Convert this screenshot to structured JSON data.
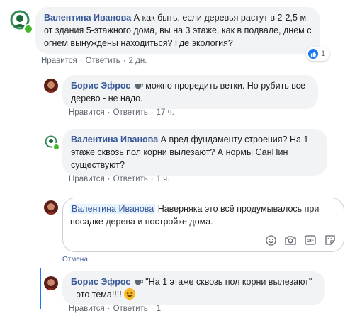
{
  "comments": [
    {
      "author": "Валентина Иванова",
      "text": "А как быть, если деревья растут в 2-2,5 м от здания 5-этажного дома, вы на 3 этаже, как в подвале, днем с огнем вынуждены находиться? Где экология?",
      "like_label": "Нравится",
      "reply_label": "Ответить",
      "time": "2 дн.",
      "reactions_count": "1"
    },
    {
      "author": "Борис Эфрос",
      "text": "можно проредить ветки. Но рубить все дерево - не надо.",
      "like_label": "Нравится",
      "reply_label": "Ответить",
      "time": "17 ч."
    },
    {
      "author": "Валентина Иванова",
      "text": "А вред фундаменту строения? На 1 этаже сквозь пол корни вылезают? А нормы СанПин существуют?",
      "like_label": "Нравится",
      "reply_label": "Ответить",
      "time": "1 ч."
    },
    {
      "author": "Борис Эфрос",
      "text": "\"На 1 этаже сквозь пол корни вылезают\" - это тема!!!!",
      "like_label": "Нравится",
      "reply_label": "Ответить",
      "time": "1"
    }
  ],
  "composer": {
    "mention": "Валентина Иванова",
    "text": "Наверняка это всё продумывалось при посадке дерева и постройке дома.",
    "cancel_label": "Отмена"
  },
  "colors": {
    "link": "#385898",
    "bubble": "#f2f3f5",
    "like": "#1877f2",
    "online": "#42b72a"
  },
  "icons": [
    "thumbs-up-icon",
    "coffee-cup-icon",
    "smiley-icon",
    "camera-icon",
    "gif-icon",
    "sticker-icon"
  ]
}
